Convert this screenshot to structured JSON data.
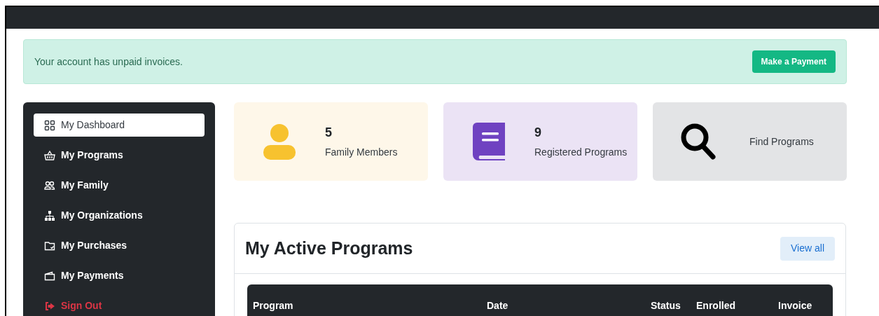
{
  "alert": {
    "message": "Your account has unpaid invoices.",
    "button": "Make a Payment"
  },
  "sidebar": {
    "items": [
      {
        "label": "My Dashboard",
        "selected": true,
        "kind": "nav"
      },
      {
        "label": "My Programs",
        "selected": false,
        "kind": "nav"
      },
      {
        "label": "My Family",
        "selected": false,
        "kind": "nav"
      },
      {
        "label": "My Organizations",
        "selected": false,
        "kind": "nav"
      },
      {
        "label": "My Purchases",
        "selected": false,
        "kind": "nav"
      },
      {
        "label": "My Payments",
        "selected": false,
        "kind": "nav"
      },
      {
        "label": "Sign Out",
        "selected": false,
        "kind": "signout"
      }
    ]
  },
  "cards": [
    {
      "kind": "person",
      "count": "5",
      "label": "Family Members",
      "color": "#fef7e9"
    },
    {
      "kind": "book",
      "count": "9",
      "label": "Registered Programs",
      "color": "#ebe3f5"
    },
    {
      "kind": "search",
      "label": "Find Programs",
      "color": "#e3e4e6"
    }
  ],
  "active_programs": {
    "title": "My Active Programs",
    "button": "View all",
    "table": {
      "columns": [
        "Program",
        "Date",
        "Status",
        "Enrolled",
        "Invoice"
      ]
    }
  }
}
